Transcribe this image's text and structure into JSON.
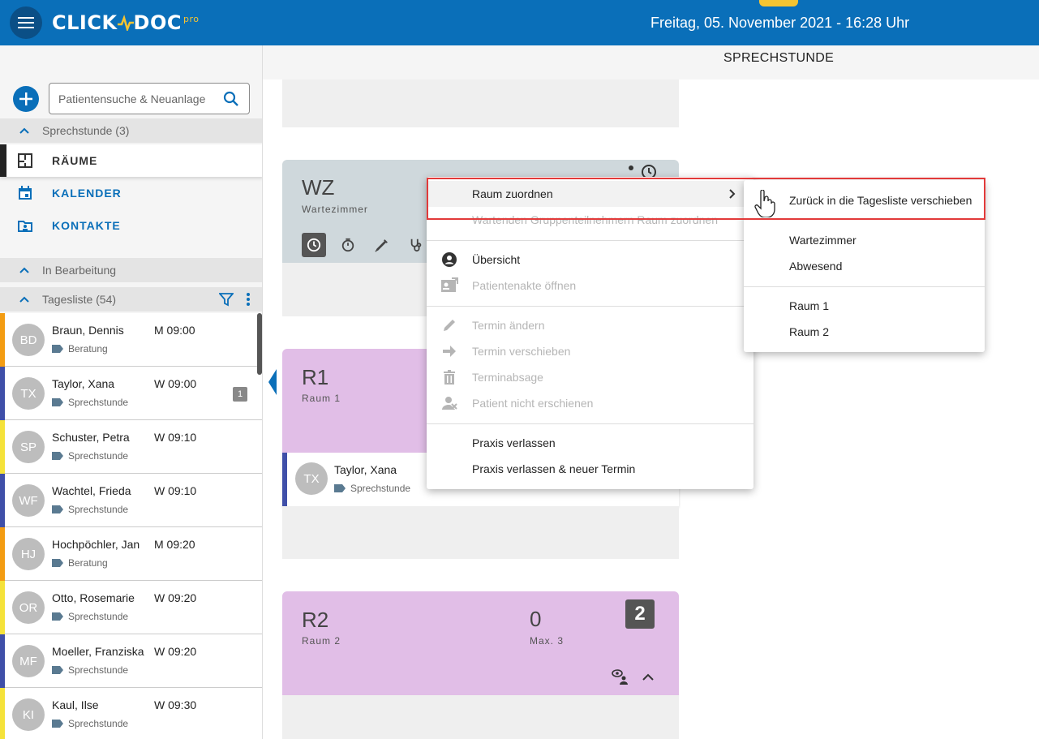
{
  "app": {
    "logo_text": "CLICK",
    "logo_text2": "DOC",
    "logo_suffix": "pro",
    "date": "Freitag, 05. November 2021 - 16:28 Uhr",
    "page_title": "SPRECHSTUNDE"
  },
  "sidebar": {
    "search_placeholder": "Patientensuche & Neuanlage",
    "sections": {
      "sprechstunde": "Sprechstunde (3)",
      "in_bearbeitung": "In Bearbeitung",
      "tagesliste": "Tagesliste (54)"
    },
    "nav": [
      {
        "label": "RÄUME",
        "icon": "floorplan-icon"
      },
      {
        "label": "KALENDER",
        "icon": "calendar-icon"
      },
      {
        "label": "KONTAKTE",
        "icon": "contacts-icon"
      }
    ],
    "patients": [
      {
        "initials": "BD",
        "name": "Braun, Dennis",
        "time": "M 09:00",
        "type": "Beratung",
        "color": "#f39c12",
        "badge": ""
      },
      {
        "initials": "TX",
        "name": "Taylor, Xana",
        "time": "W 09:00",
        "type": "Sprechstunde",
        "color": "#3f4fa8",
        "badge": "1"
      },
      {
        "initials": "SP",
        "name": "Schuster, Petra",
        "time": "W 09:10",
        "type": "Sprechstunde",
        "color": "#f5e23a",
        "badge": ""
      },
      {
        "initials": "WF",
        "name": "Wachtel, Frieda",
        "time": "W 09:10",
        "type": "Sprechstunde",
        "color": "#3f4fa8",
        "badge": ""
      },
      {
        "initials": "HJ",
        "name": "Hochpöchler, Jan",
        "time": "M 09:20",
        "type": "Beratung",
        "color": "#f39c12",
        "badge": ""
      },
      {
        "initials": "OR",
        "name": "Otto, Rosemarie",
        "time": "W 09:20",
        "type": "Sprechstunde",
        "color": "#f5e23a",
        "badge": ""
      },
      {
        "initials": "MF",
        "name": "Moeller, Franziska",
        "time": "W 09:20",
        "type": "Sprechstunde",
        "color": "#3f4fa8",
        "badge": ""
      },
      {
        "initials": "KI",
        "name": "Kaul, Ilse",
        "time": "W 09:30",
        "type": "Sprechstunde",
        "color": "#f5e23a",
        "badge": ""
      }
    ]
  },
  "rooms": {
    "wz": {
      "code": "WZ",
      "name": "Wartezimmer",
      "color": "#cfd8dc"
    },
    "r1": {
      "code": "R1",
      "name": "Raum 1",
      "color": "#e1bee7",
      "patient": {
        "initials": "TX",
        "name": "Taylor, Xana",
        "type": "Sprechstunde"
      }
    },
    "r2": {
      "code": "R2",
      "name": "Raum 2",
      "count": "0",
      "max": "Max. 3",
      "badge": "2",
      "color": "#e1bee7"
    }
  },
  "context_menu": {
    "items": [
      {
        "label": "Raum zuordnen",
        "icon": "",
        "disabled": false
      },
      {
        "label": "Wartenden Gruppenteilnehmern Raum zuordnen",
        "icon": "",
        "disabled": true
      },
      {
        "label": "Übersicht",
        "icon": "account-circle-icon",
        "disabled": false
      },
      {
        "label": "Patientenakte öffnen",
        "icon": "patient-file-icon",
        "disabled": true
      },
      {
        "label": "Termin ändern",
        "icon": "pencil-icon",
        "disabled": true
      },
      {
        "label": "Termin verschieben",
        "icon": "arrow-right-icon",
        "disabled": true
      },
      {
        "label": "Terminabsage",
        "icon": "trash-icon",
        "disabled": true
      },
      {
        "label": "Patient nicht erschienen",
        "icon": "person-off-icon",
        "disabled": true
      },
      {
        "label": "Praxis verlassen",
        "icon": "",
        "disabled": false
      },
      {
        "label": "Praxis verlassen & neuer Termin",
        "icon": "",
        "disabled": false
      }
    ]
  },
  "submenu": {
    "items": [
      "Zurück in die Tagesliste verschieben",
      "Wartezimmer",
      "Abwesend",
      "Raum 1",
      "Raum 2"
    ]
  },
  "colors": {
    "primary": "#0a6fb9",
    "highlight": "#e23a3a",
    "disabled": "#b5b5b5"
  }
}
